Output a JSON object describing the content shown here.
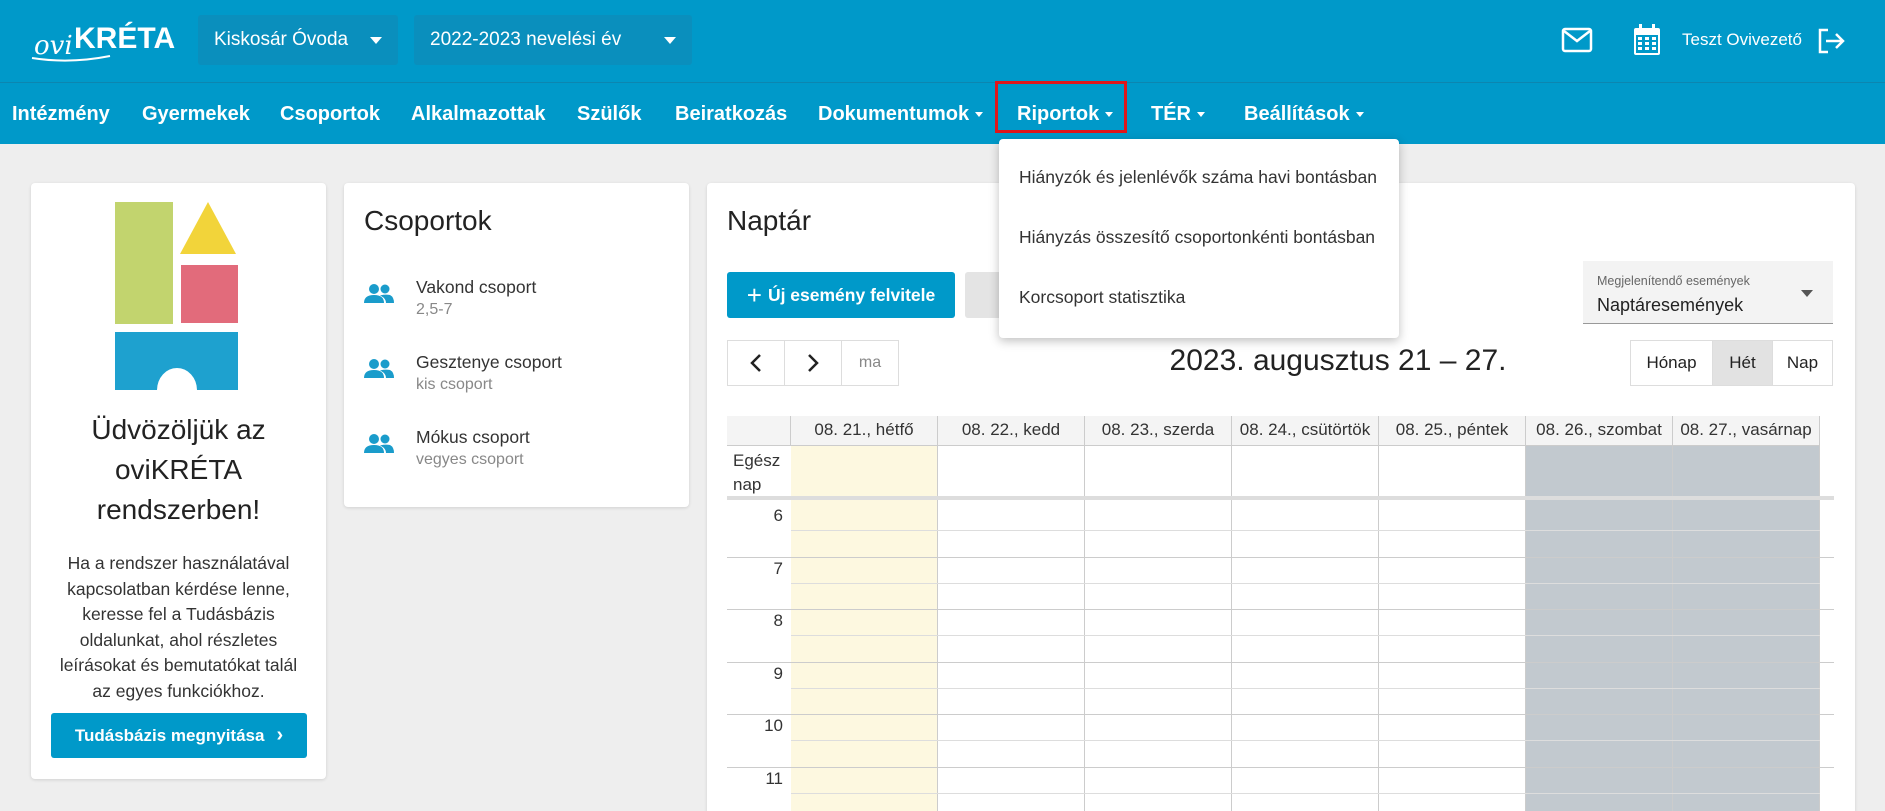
{
  "header": {
    "logo_text": "oviKRÉTA",
    "institution": "Kiskosár Óvoda",
    "school_year": "2022-2023 nevelési év",
    "user_name": "Teszt Ovivezető"
  },
  "nav": {
    "items": [
      {
        "label": "Intézmény"
      },
      {
        "label": "Gyermekek"
      },
      {
        "label": "Csoportok"
      },
      {
        "label": "Alkalmazottak"
      },
      {
        "label": "Szülők"
      },
      {
        "label": "Beiratkozás"
      },
      {
        "label": "Dokumentumok"
      },
      {
        "label": "Riportok"
      },
      {
        "label": "TÉR"
      },
      {
        "label": "Beállítások"
      }
    ]
  },
  "riportok_menu": {
    "items": [
      "Hiányzók és jelenlévők száma havi bontásban",
      "Hiányzás összesítő csoportonkénti bontásban",
      "Korcsoport statisztika"
    ]
  },
  "welcome": {
    "title_line1": "Üdvözöljük az",
    "title_line2": "oviKRÉTA",
    "title_line3": "rendszerben!",
    "text_lines": [
      "Ha a rendszer használatával",
      "kapcsolatban kérdése lenne,",
      "keresse fel a Tudásbázis",
      "oldalunkat, ahol részletes",
      "leírásokat és bemutatókat talál",
      "az egyes funkciókhoz."
    ],
    "button_label": "Tudásbázis megnyitása"
  },
  "groups": {
    "title": "Csoportok",
    "items": [
      {
        "name": "Vakond csoport",
        "sub": "2,5-7"
      },
      {
        "name": "Gesztenye csoport",
        "sub": "kis csoport"
      },
      {
        "name": "Mókus csoport",
        "sub": "vegyes csoport"
      }
    ]
  },
  "calendar": {
    "title": "Naptár",
    "new_event_label": "Új esemény felvitele",
    "filter_label": "Megjelenítendő események",
    "filter_value": "Naptáresemények",
    "today_label": "ma",
    "range": "2023. augusztus 21 – 27.",
    "views": [
      "Hónap",
      "Hét",
      "Nap"
    ],
    "allday_line1": "Egész",
    "allday_line2": "nap",
    "days": [
      "08. 21., hétfő",
      "08. 22., kedd",
      "08. 23., szerda",
      "08. 24., csütörtök",
      "08. 25., péntek",
      "08. 26., szombat",
      "08. 27., vasárnap"
    ],
    "hours": [
      "6",
      "7",
      "8",
      "9",
      "10",
      "11"
    ],
    "colors": {
      "today": "#fdf8e0",
      "weekend": "#c2c9cf",
      "accent": "#0099c9"
    }
  }
}
